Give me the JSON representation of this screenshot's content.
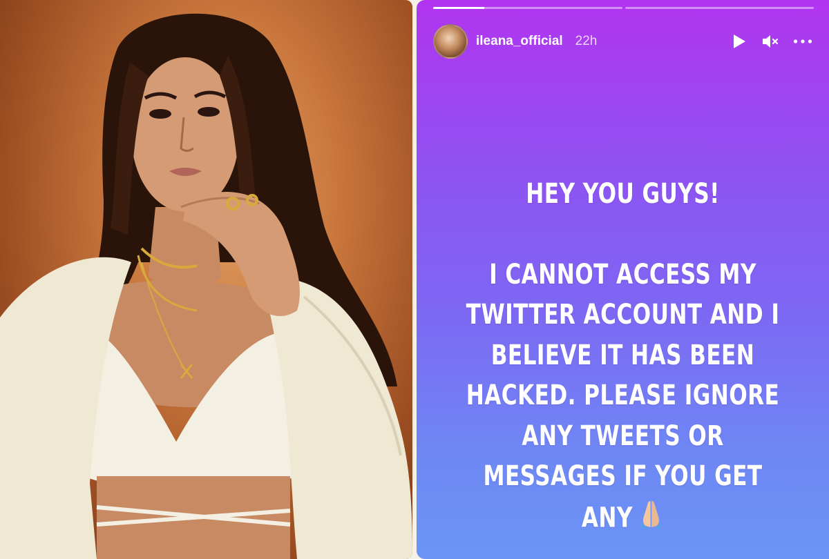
{
  "photo": {
    "alt_description_icon": "portrait-photo"
  },
  "story": {
    "progress": [
      0.27,
      0
    ],
    "user": {
      "username": "ileana_official",
      "time_ago": "22h",
      "avatar_icon": "profile-avatar"
    },
    "controls": {
      "play_icon": "play-icon",
      "mute_icon": "speaker-muted-icon",
      "more_icon": "more-dots-icon"
    },
    "message": {
      "line1": "HEY YOU GUYS!",
      "line2": "I CANNOT ACCESS MY",
      "line3": "TWITTER ACCOUNT AND I",
      "line4": "BELIEVE IT HAS BEEN",
      "line5": "HACKED. PLEASE IGNORE",
      "line6": "ANY TWEETS OR",
      "line7": "MESSAGES IF YOU GET",
      "line8": "ANY",
      "emoji_icon": "folded-hands-emoji"
    },
    "colors": {
      "gradient_top": "#b234f0",
      "gradient_bottom": "#6a95f5"
    }
  }
}
